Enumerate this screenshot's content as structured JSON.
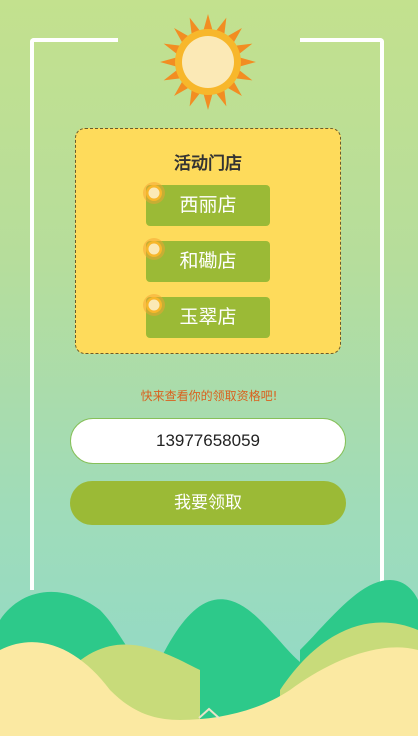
{
  "card": {
    "title": "活动门店",
    "stores": [
      {
        "label": "西丽店"
      },
      {
        "label": "和磡店"
      },
      {
        "label": "玉翠店"
      }
    ]
  },
  "hint": "快来查看你的领取资格吧!",
  "phone": {
    "value": "13977658059"
  },
  "claim_label": "我要领取",
  "colors": {
    "accent_green": "#9bba36",
    "card_yellow": "#fedb5b",
    "hint_orange": "#d9611f"
  }
}
